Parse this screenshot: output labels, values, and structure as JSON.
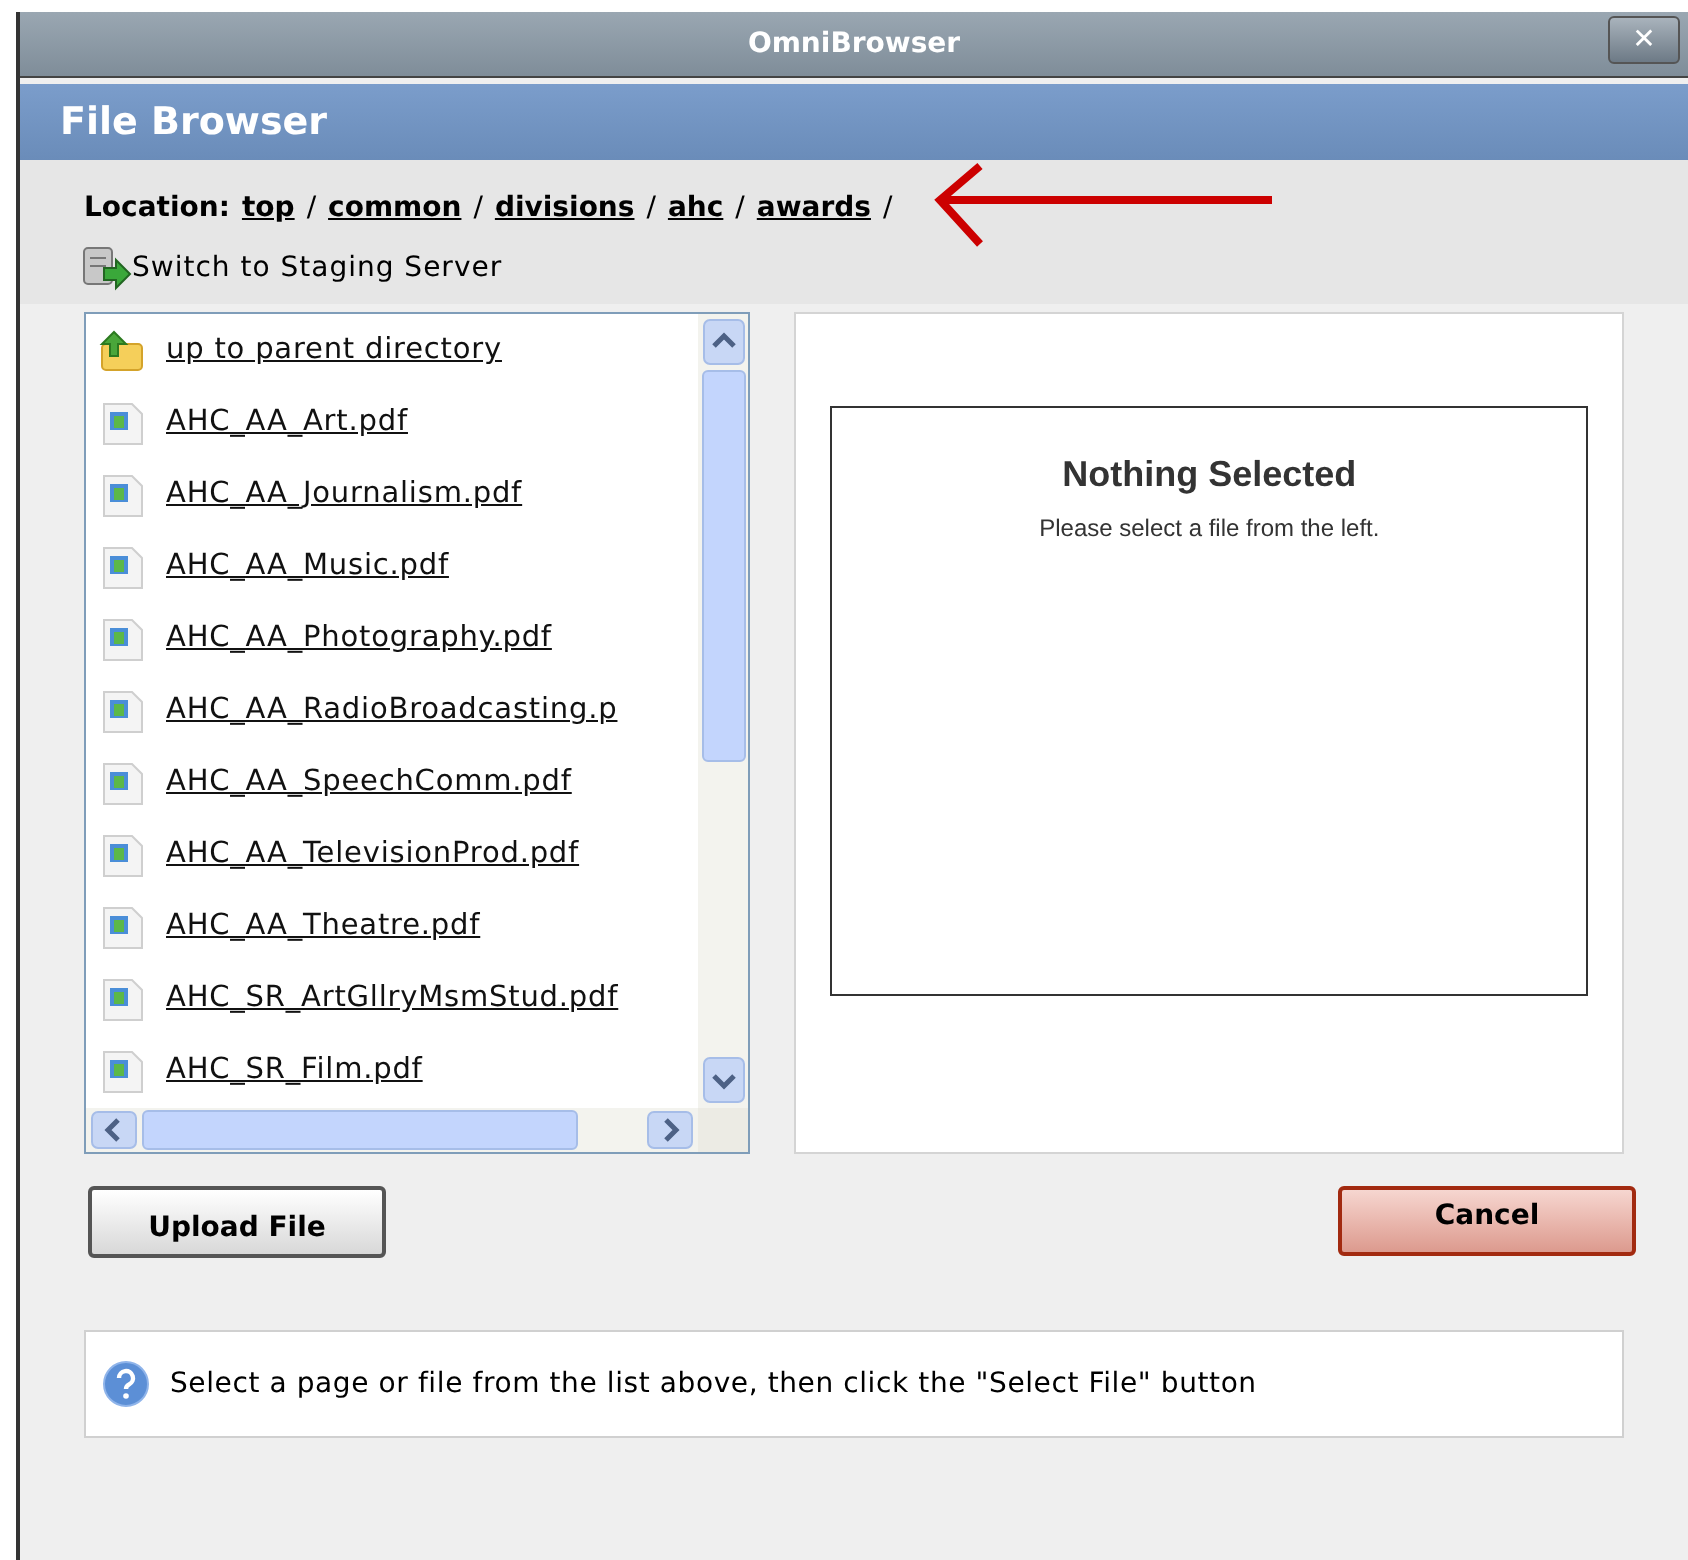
{
  "window": {
    "title": "OmniBrowser",
    "close": "✕"
  },
  "panel": {
    "title": "File Browser"
  },
  "location": {
    "label": "Location:",
    "parts": [
      {
        "kind": "link",
        "text": "top"
      },
      {
        "kind": "sep",
        "text": "/"
      },
      {
        "kind": "link",
        "text": "common"
      },
      {
        "kind": "sep",
        "text": "/"
      },
      {
        "kind": "link",
        "text": "divisions"
      },
      {
        "kind": "sep",
        "text": "/"
      },
      {
        "kind": "link",
        "text": "ahc"
      },
      {
        "kind": "sep",
        "text": "/"
      },
      {
        "kind": "link",
        "text": "awards"
      },
      {
        "kind": "sep",
        "text": "/"
      }
    ]
  },
  "staging_link": "Switch to Staging Server",
  "file_list": [
    {
      "kind": "parent",
      "label": "up to parent directory"
    },
    {
      "kind": "file",
      "label": "AHC_AA_Art.pdf"
    },
    {
      "kind": "file",
      "label": "AHC_AA_Journalism.pdf"
    },
    {
      "kind": "file",
      "label": "AHC_AA_Music.pdf"
    },
    {
      "kind": "file",
      "label": "AHC_AA_Photography.pdf"
    },
    {
      "kind": "file",
      "label": "AHC_AA_RadioBroadcasting.p"
    },
    {
      "kind": "file",
      "label": "AHC_AA_SpeechComm.pdf"
    },
    {
      "kind": "file",
      "label": "AHC_AA_TelevisionProd.pdf"
    },
    {
      "kind": "file",
      "label": "AHC_AA_Theatre.pdf"
    },
    {
      "kind": "file",
      "label": "AHC_SR_ArtGllryMsmStud.pdf"
    },
    {
      "kind": "file",
      "label": "AHC_SR_Film.pdf"
    }
  ],
  "preview": {
    "title": "Nothing Selected",
    "message": "Please select a file from the left."
  },
  "buttons": [
    {
      "kind": "upload",
      "label": "Upload File"
    },
    {
      "kind": "cancel",
      "label": "Cancel"
    }
  ],
  "info": "Select a page or file from the list above, then click the \"Select File\" button"
}
